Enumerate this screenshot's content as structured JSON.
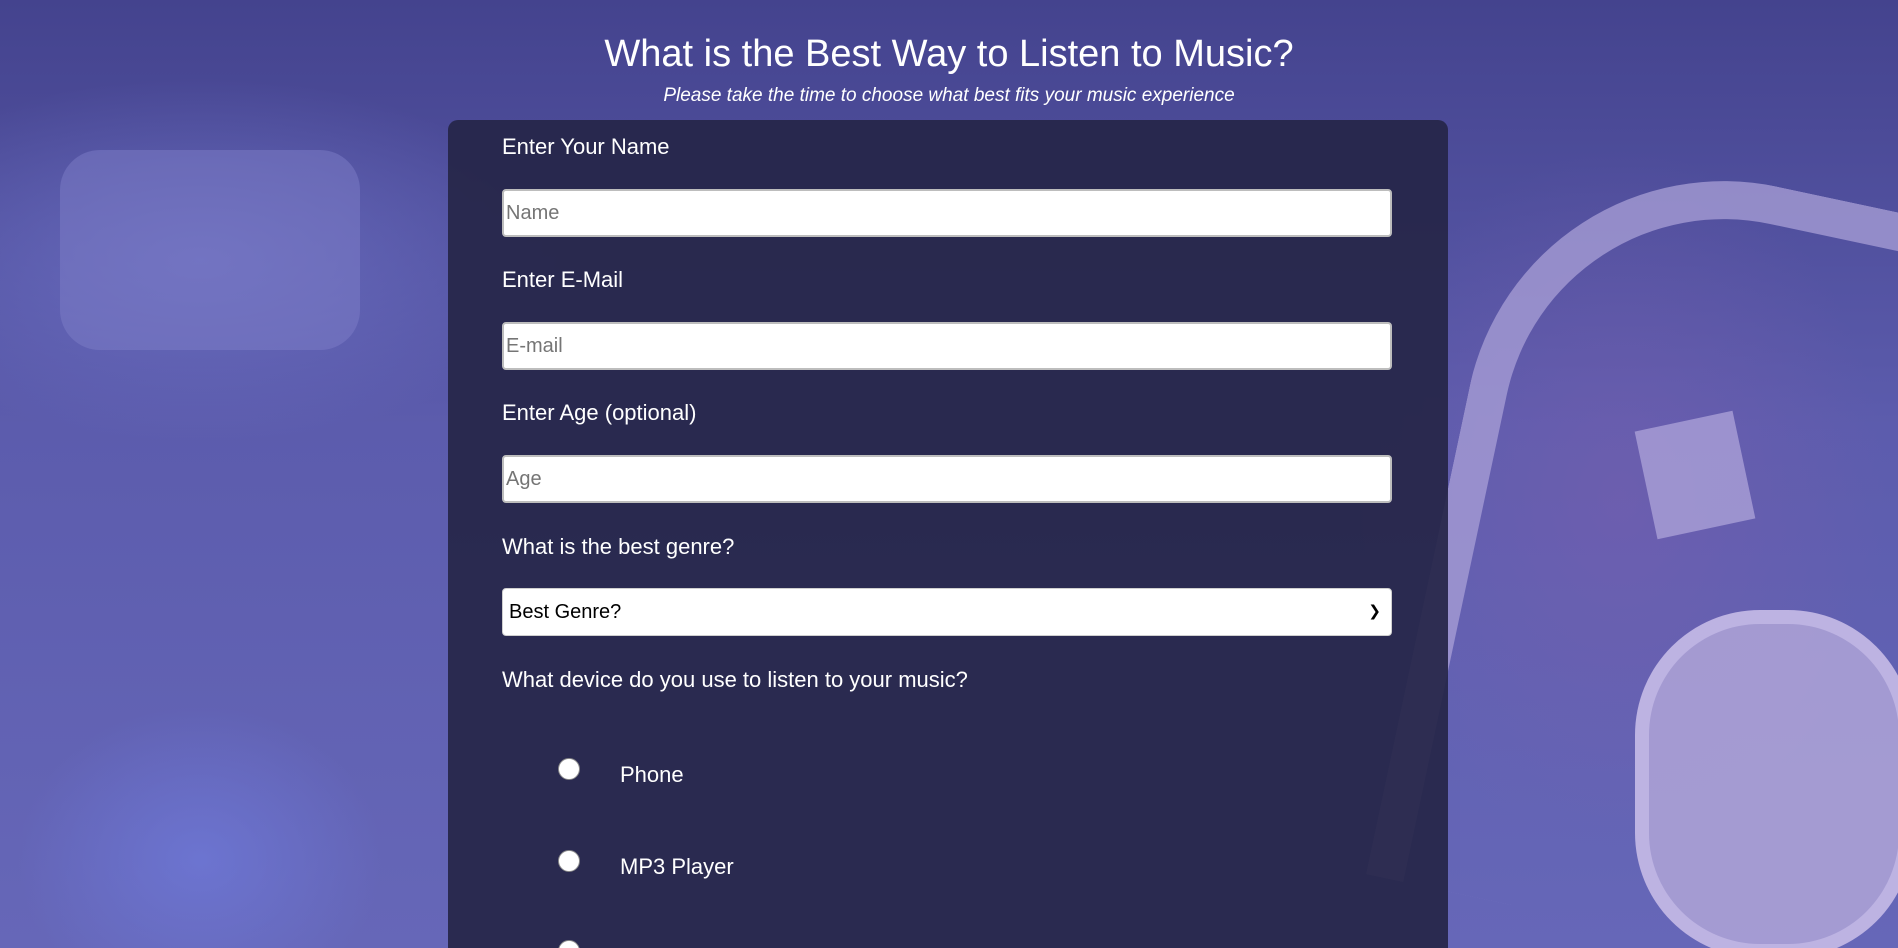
{
  "header": {
    "title": "What is the Best Way to Listen to Music?",
    "subtitle": "Please take the time to choose what best fits your music experience"
  },
  "form": {
    "name": {
      "label": "Enter Your Name",
      "placeholder": "Name",
      "value": ""
    },
    "email": {
      "label": "Enter E-Mail",
      "placeholder": "E-mail",
      "value": ""
    },
    "age": {
      "label": "Enter Age (optional)",
      "placeholder": "Age",
      "value": ""
    },
    "genre": {
      "label": "What is the best genre?",
      "selected": "Best Genre?"
    },
    "device": {
      "label": "What device do you use to listen to your music?",
      "options": [
        {
          "label": "Phone",
          "checked": false
        },
        {
          "label": "MP3 Player",
          "checked": false
        },
        {
          "label": "",
          "checked": false
        }
      ]
    }
  },
  "colors": {
    "card": "#262648",
    "background": "#5c5cad",
    "text": "#ffffff"
  }
}
